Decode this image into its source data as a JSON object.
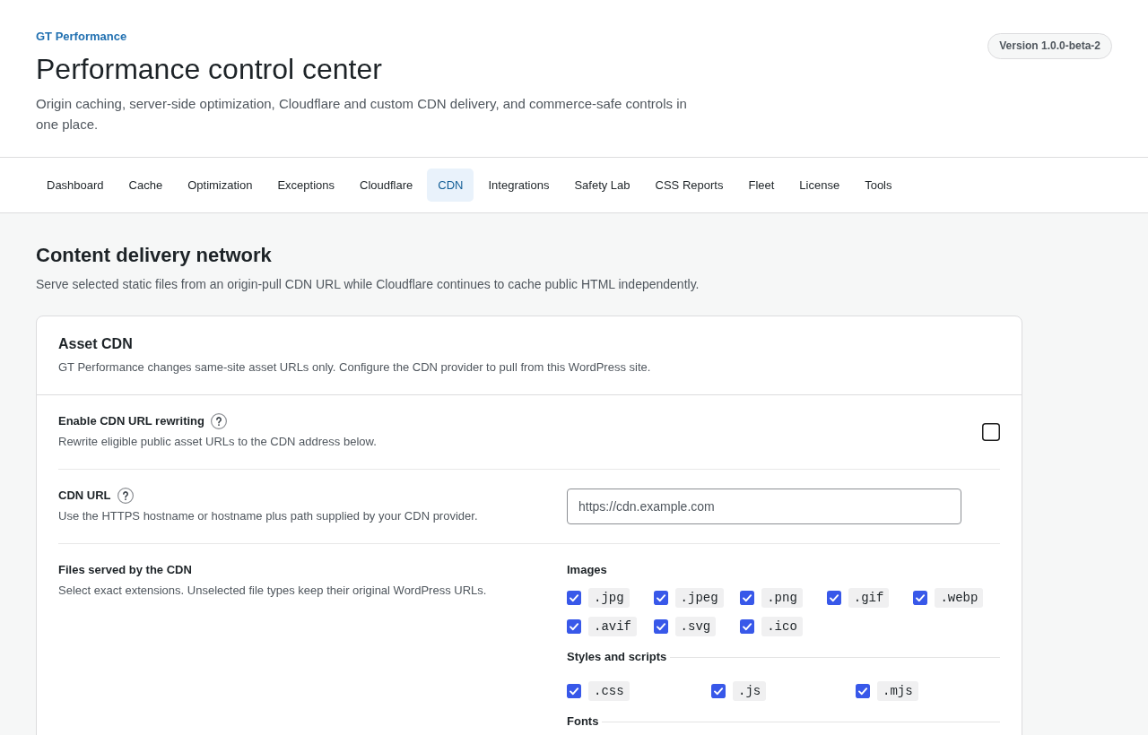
{
  "header": {
    "brand": "GT Performance",
    "title": "Performance control center",
    "description": "Origin caching, server-side optimization, Cloudflare and custom CDN delivery, and commerce-safe controls in one place.",
    "version": "Version 1.0.0-beta-2"
  },
  "tabs": [
    {
      "label": "Dashboard",
      "selected": false
    },
    {
      "label": "Cache",
      "selected": false
    },
    {
      "label": "Optimization",
      "selected": false
    },
    {
      "label": "Exceptions",
      "selected": false
    },
    {
      "label": "Cloudflare",
      "selected": false
    },
    {
      "label": "CDN",
      "selected": true
    },
    {
      "label": "Integrations",
      "selected": false
    },
    {
      "label": "Safety Lab",
      "selected": false
    },
    {
      "label": "CSS Reports",
      "selected": false
    },
    {
      "label": "Fleet",
      "selected": false
    },
    {
      "label": "License",
      "selected": false
    },
    {
      "label": "Tools",
      "selected": false
    }
  ],
  "section": {
    "title": "Content delivery network",
    "description": "Serve selected static files from an origin-pull CDN URL while Cloudflare continues to cache public HTML independently."
  },
  "card": {
    "title": "Asset CDN",
    "description": "GT Performance changes same-site asset URLs only. Configure the CDN provider to pull from this WordPress site.",
    "settings": [
      {
        "kind": "checkbox",
        "label": "Enable CDN URL rewriting",
        "help": true,
        "description": "Rewrite eligible public asset URLs to the CDN address below.",
        "checked": false
      },
      {
        "kind": "url",
        "label": "CDN URL",
        "help": true,
        "description": "Use the HTTPS hostname or hostname plus path supplied by your CDN provider.",
        "placeholder": "https://cdn.example.com"
      },
      {
        "kind": "extensions",
        "label": "Files served by the CDN",
        "help": false,
        "description": "Select exact extensions. Unselected file types keep their original WordPress URLs.",
        "groups": [
          {
            "title": "Images",
            "items": [
              {
                "extension": ".jpg",
                "checked": true
              },
              {
                "extension": ".jpeg",
                "checked": true
              },
              {
                "extension": ".png",
                "checked": true
              },
              {
                "extension": ".gif",
                "checked": true
              },
              {
                "extension": ".webp",
                "checked": true
              },
              {
                "extension": ".avif",
                "checked": true
              },
              {
                "extension": ".svg",
                "checked": true
              },
              {
                "extension": ".ico",
                "checked": true
              }
            ]
          },
          {
            "title": "Styles and scripts",
            "items": [
              {
                "extension": ".css",
                "checked": true
              },
              {
                "extension": ".js",
                "checked": true
              },
              {
                "extension": ".mjs",
                "checked": true
              }
            ]
          },
          {
            "title": "Fonts"
          }
        ]
      }
    ]
  }
}
